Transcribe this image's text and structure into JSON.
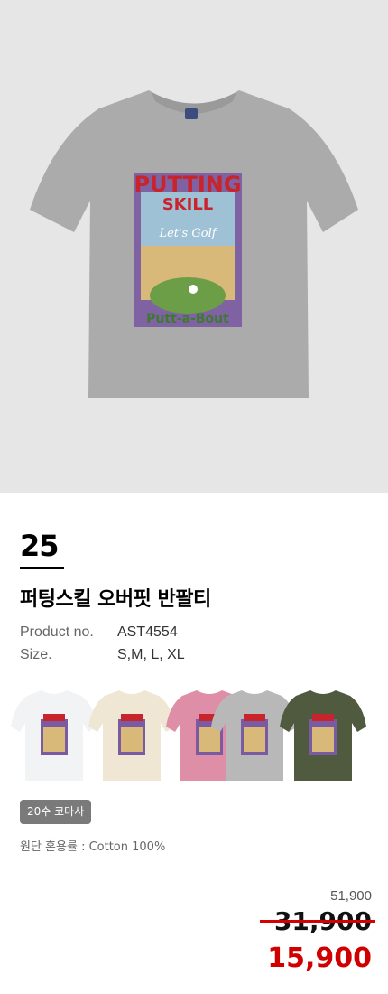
{
  "product": {
    "number": "25",
    "title": "퍼팅스킬 오버핏 반팔티",
    "meta": [
      {
        "label": "Product no.",
        "value": "AST4554"
      },
      {
        "label": "Size.",
        "value": "S,M, L, XL"
      }
    ],
    "badge": "20수 코마사",
    "fabric": "원단 혼용률 : Cotton 100%",
    "graphic": {
      "title_text": "PUTTING",
      "subtitle_text": "SKILL",
      "script_text": "Let's Golf",
      "bottom_text": "Putt-a-Bout"
    },
    "colors": [
      {
        "name": "white",
        "hex": "#f1f3f4"
      },
      {
        "name": "cream",
        "hex": "#efe7d3"
      },
      {
        "name": "pink",
        "hex": "#df8ea8"
      },
      {
        "name": "gray",
        "hex": "#b8b8b8"
      },
      {
        "name": "khaki",
        "hex": "#4f5a3f"
      }
    ],
    "main_color": "#ababab"
  },
  "pricing": {
    "original": "51,900",
    "discounted": "31,900",
    "final": "15,900",
    "accent": "#d10000"
  }
}
